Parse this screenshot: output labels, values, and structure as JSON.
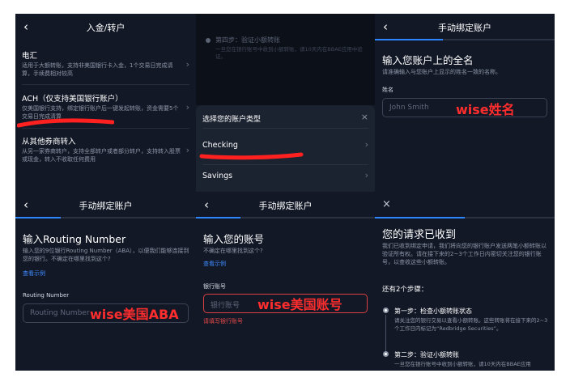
{
  "panel1": {
    "title": "入金/转户",
    "back": "‹",
    "options": [
      {
        "title": "电汇",
        "desc": "适用于大额转账，支持非美国银行卡入金，1个交易日完成请算，手续费相对较高"
      },
      {
        "title": "ACH（仅支持美国银行账户）",
        "desc": "仅美国银行支持，绑定银行账户后一键发起转账，资金需要5个交易日完成清算"
      },
      {
        "title": "从其他券商转入",
        "desc": "从另一家券商转户，支持全部转户或者部分转户，支持转入股票或现金，转入不收取任何费用"
      }
    ]
  },
  "panel2": {
    "bg_step_text": "第四步：验证小额转账",
    "bg_step_desc": "一旦您在银行账号中收到小额转账，请10天内在BBAE应用中验证。",
    "sheet_title": "选择您的账户类型",
    "options": [
      "Checking",
      "Savings"
    ]
  },
  "panel3": {
    "title": "手动绑定账户",
    "heading": "输入您账户上的全名",
    "sub": "请准确输入与您账户上显示的姓名一致的名称。",
    "field_label": "姓名",
    "placeholder": "John Smith",
    "annotation": "wise姓名"
  },
  "panel4": {
    "title": "手动绑定账户",
    "heading": "输入Routing Number",
    "sub": "输入您的9位银行Routing Number（ABA），以便我们能够连接到您的银行。不确定在哪里找到这个?",
    "link": "查看示例",
    "field_label": "Routing Number",
    "placeholder": "Routing Number",
    "annotation": "wise美国ABA"
  },
  "panel5": {
    "title": "手动绑定账户",
    "heading": "输入您的账号",
    "sub": "不确定在哪里找到这个?",
    "link": "查看示例",
    "field_label": "银行账号",
    "placeholder": "银行账号",
    "annotation": "wise美国账号",
    "error": "请填写银行账号"
  },
  "panel6": {
    "heading": "您的请求已收到",
    "sub": "我们已收到绑定申请，我们将向您的银行账户发送两笔小额转账以验证所有权。请在接下来的2~3个工作日内密切关注您的银行账号，以查收这些小额转账。",
    "steps_title": "还有2个步骤：",
    "steps": [
      {
        "title": "第一步：检查小额转账状态",
        "desc": "请关注您的银行交易以查看小额转账。这些转账将在接下来的2~3个工作日内标记为“Redbridge Securities”。"
      },
      {
        "title": "第二步：验证小额转账",
        "desc": "一旦您在银行账号中收到小额转账，请10天内在BBAE应用"
      }
    ]
  },
  "icons": {
    "chevron": "›",
    "close": "×",
    "back": "‹"
  },
  "colors": {
    "bg": "#121826",
    "accent": "#2e86ff",
    "annotation": "#ff2d2d",
    "error": "#e74848"
  }
}
